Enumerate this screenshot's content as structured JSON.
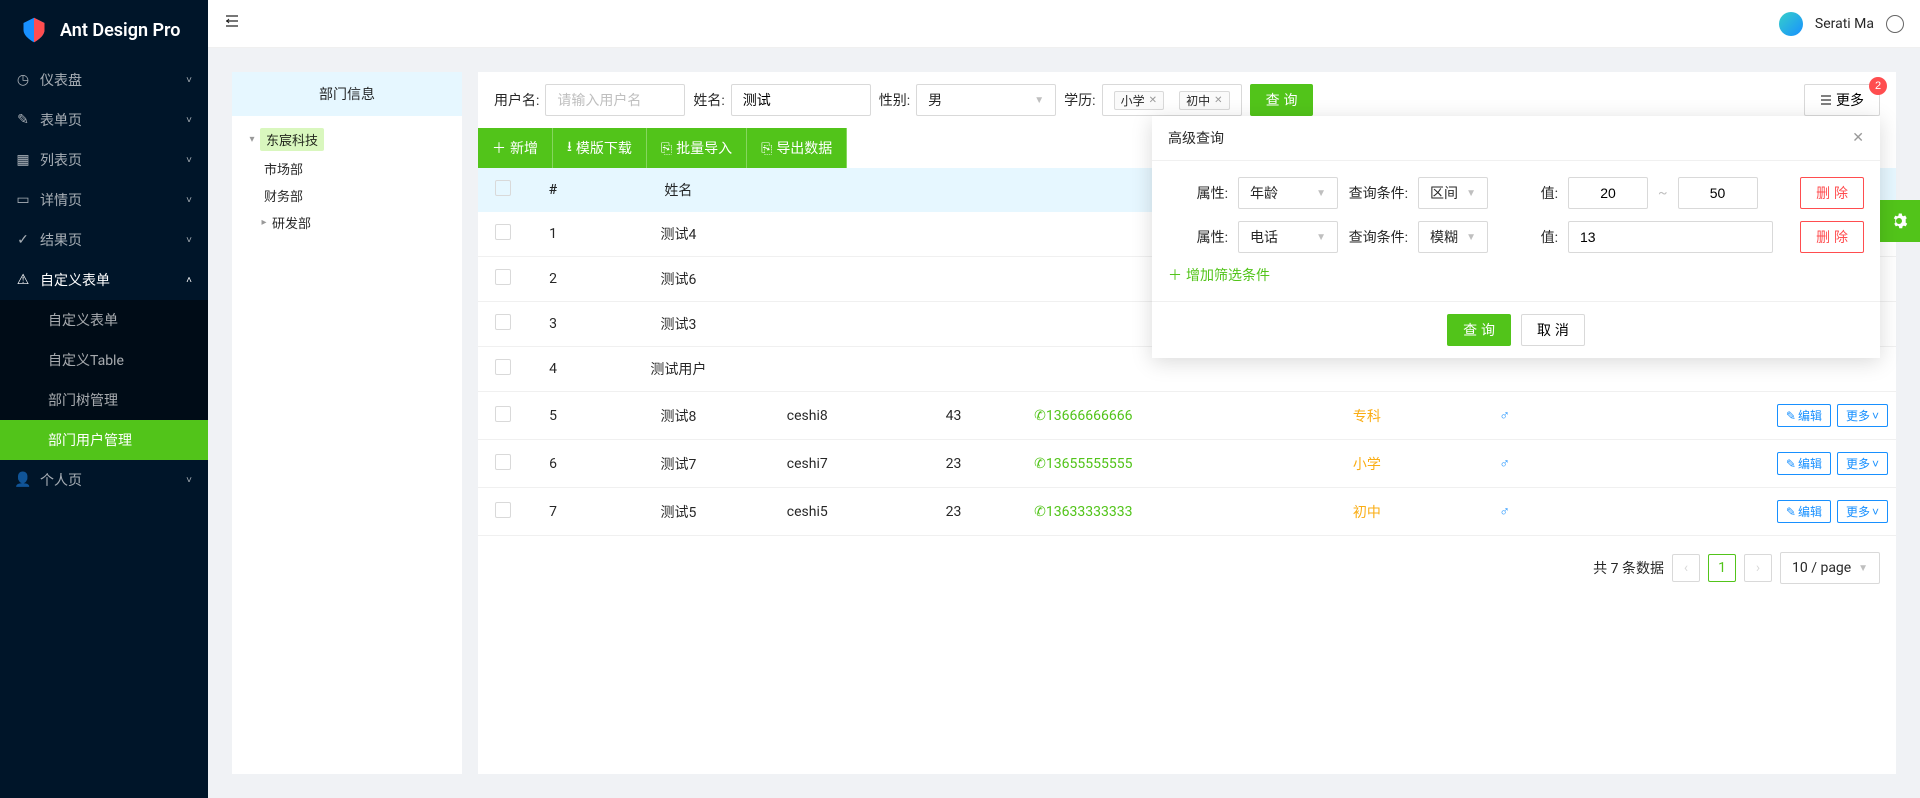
{
  "app": {
    "title": "Ant Design Pro"
  },
  "header": {
    "username": "Serati Ma"
  },
  "sidebar": {
    "items": [
      {
        "label": "仪表盘",
        "icon": "dashboard"
      },
      {
        "label": "表单页",
        "icon": "form"
      },
      {
        "label": "列表页",
        "icon": "table"
      },
      {
        "label": "详情页",
        "icon": "detail"
      },
      {
        "label": "结果页",
        "icon": "result"
      },
      {
        "label": "自定义表单",
        "icon": "warning",
        "open": true,
        "children": [
          {
            "label": "自定义表单"
          },
          {
            "label": "自定义Table"
          },
          {
            "label": "部门树管理"
          },
          {
            "label": "部门用户管理",
            "selected": true
          }
        ]
      },
      {
        "label": "个人页",
        "icon": "user"
      }
    ]
  },
  "tree": {
    "title": "部门信息",
    "nodes": [
      {
        "label": "东宸科技",
        "expanded": true,
        "selected": true,
        "children": [
          {
            "label": "市场部"
          },
          {
            "label": "财务部"
          },
          {
            "label": "研发部",
            "hasChildren": true
          }
        ]
      }
    ]
  },
  "search": {
    "username_label": "用户名:",
    "username_placeholder": "请输入用户名",
    "username_value": "",
    "name_label": "姓名:",
    "name_value": "测试",
    "gender_label": "性别:",
    "gender_value": "男",
    "edu_label": "学历:",
    "edu_tags": [
      "小学",
      "初中"
    ],
    "query_btn": "查 询",
    "more_btn": "更多",
    "more_badge": "2"
  },
  "toolbar": {
    "add": "新增",
    "download": "模版下载",
    "import": "批量导入",
    "export": "导出数据"
  },
  "table": {
    "columns": [
      "#",
      "姓名",
      "",
      "",
      "",
      "",
      "",
      ""
    ],
    "rows": [
      {
        "idx": "1",
        "name": "测试4"
      },
      {
        "idx": "2",
        "name": "测试6"
      },
      {
        "idx": "3",
        "name": "测试3"
      },
      {
        "idx": "4",
        "name": "测试用户"
      },
      {
        "idx": "5",
        "name": "测试8",
        "col3": "ceshi8",
        "col4": "43",
        "phone": "13666666666",
        "edu": "专科",
        "gender": "♂"
      },
      {
        "idx": "6",
        "name": "测试7",
        "col3": "ceshi7",
        "col4": "23",
        "phone": "13655555555",
        "edu": "小学",
        "gender": "♂"
      },
      {
        "idx": "7",
        "name": "测试5",
        "col3": "ceshi5",
        "col4": "23",
        "phone": "13633333333",
        "edu": "初中",
        "gender": "♂"
      }
    ],
    "edit_btn": "编辑",
    "more_btn": "更多"
  },
  "pagination": {
    "total_text": "共 7 条数据",
    "page": "1",
    "size": "10 / page"
  },
  "adv": {
    "title": "高级查询",
    "attr_label": "属性:",
    "cond_label": "查询条件:",
    "val_label": "值:",
    "rows": [
      {
        "attr": "年龄",
        "cond": "区间",
        "val1": "20",
        "val2": "50",
        "range": true
      },
      {
        "attr": "电话",
        "cond": "模糊",
        "val1": "13",
        "range": false
      }
    ],
    "range_sep": "~",
    "delete_btn": "删 除",
    "add_cond": "增加筛选条件",
    "query_btn": "查 询",
    "cancel_btn": "取 消"
  }
}
